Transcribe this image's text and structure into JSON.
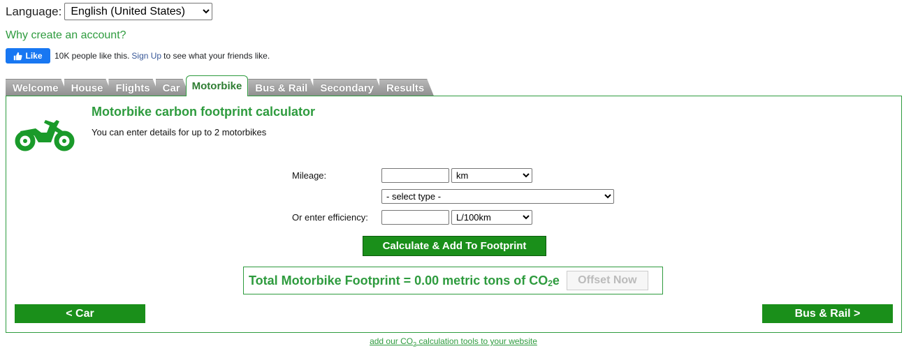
{
  "language": {
    "label": "Language:",
    "selected": "English (United States)"
  },
  "why_link": "Why create an account?",
  "facebook": {
    "like_label": "Like",
    "count_text": "10K people like this.",
    "signup_label": "Sign Up",
    "suffix_text": "to see what your friends like."
  },
  "tabs": [
    {
      "label": "Welcome",
      "active": false
    },
    {
      "label": "House",
      "active": false
    },
    {
      "label": "Flights",
      "active": false
    },
    {
      "label": "Car",
      "active": false
    },
    {
      "label": "Motorbike",
      "active": true
    },
    {
      "label": "Bus & Rail",
      "active": false
    },
    {
      "label": "Secondary",
      "active": false
    },
    {
      "label": "Results",
      "active": false
    }
  ],
  "panel": {
    "title": "Motorbike carbon footprint calculator",
    "subtitle": "You can enter details for up to 2 motorbikes",
    "mileage_label": "Mileage:",
    "mileage_value": "",
    "mileage_unit": "km",
    "type_select": "- select type -",
    "efficiency_label": "Or enter efficiency:",
    "efficiency_value": "",
    "efficiency_unit": "L/100km",
    "calculate_button": "Calculate & Add To Footprint",
    "total_text": "Total Motorbike Footprint = 0.00 metric tons of CO",
    "total_sub": "2",
    "total_suffix": "e",
    "offset_button": "Offset Now",
    "prev_button": "< Car",
    "next_button": "Bus & Rail >"
  },
  "footer": {
    "link_prefix": "add our CO",
    "link_sub": "2",
    "link_suffix": " calculation tools to your website"
  },
  "colors": {
    "brand_green": "#2e9b3e",
    "button_green": "#1a8f1a",
    "facebook_blue": "#1877f2"
  }
}
